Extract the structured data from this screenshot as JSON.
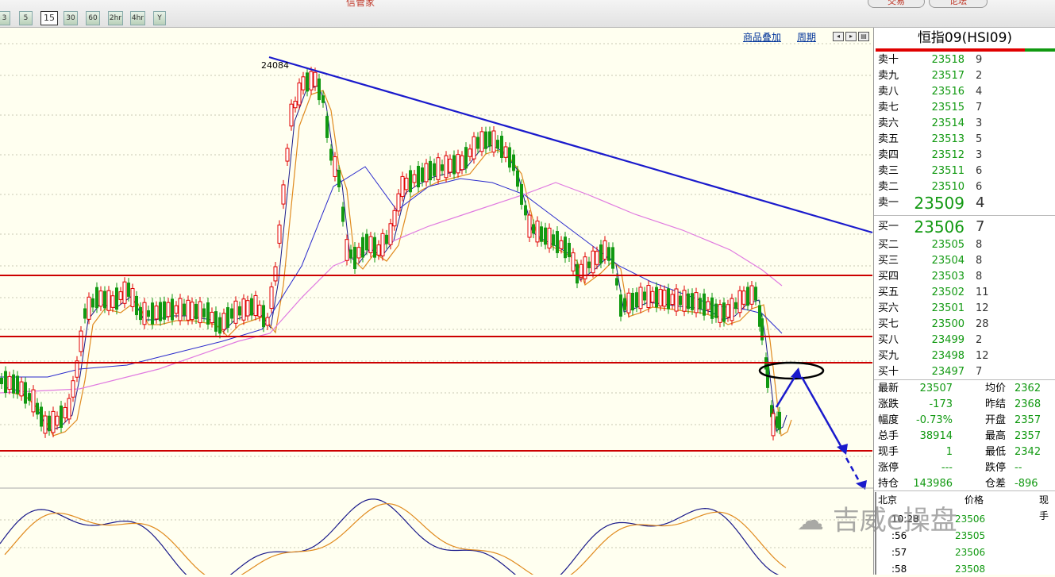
{
  "app": {
    "title": "信管家",
    "buttons": [
      "交易",
      "论坛"
    ]
  },
  "periods": [
    "3",
    "5",
    "15",
    "30",
    "60",
    "2hr",
    "4hr",
    "Y"
  ],
  "selected_period": "15",
  "chart_tools": {
    "overlay": "商品叠加",
    "cycle": "周期"
  },
  "chart": {
    "high_label": "24084"
  },
  "quote": {
    "title": "恒指09(HSI09)",
    "asks": [
      {
        "label": "卖十",
        "price": "23518",
        "vol": "9"
      },
      {
        "label": "卖九",
        "price": "23517",
        "vol": "2"
      },
      {
        "label": "卖八",
        "price": "23516",
        "vol": "4"
      },
      {
        "label": "卖七",
        "price": "23515",
        "vol": "7"
      },
      {
        "label": "卖六",
        "price": "23514",
        "vol": "3"
      },
      {
        "label": "卖五",
        "price": "23513",
        "vol": "5"
      },
      {
        "label": "卖四",
        "price": "23512",
        "vol": "3"
      },
      {
        "label": "卖三",
        "price": "23511",
        "vol": "6"
      },
      {
        "label": "卖二",
        "price": "23510",
        "vol": "6"
      },
      {
        "label": "卖一",
        "price": "23509",
        "vol": "4"
      }
    ],
    "bids": [
      {
        "label": "买一",
        "price": "23506",
        "vol": "7"
      },
      {
        "label": "买二",
        "price": "23505",
        "vol": "8"
      },
      {
        "label": "买三",
        "price": "23504",
        "vol": "8"
      },
      {
        "label": "买四",
        "price": "23503",
        "vol": "8"
      },
      {
        "label": "买五",
        "price": "23502",
        "vol": "11"
      },
      {
        "label": "买六",
        "price": "23501",
        "vol": "12"
      },
      {
        "label": "买七",
        "price": "23500",
        "vol": "28"
      },
      {
        "label": "买八",
        "price": "23499",
        "vol": "2"
      },
      {
        "label": "买九",
        "price": "23498",
        "vol": "12"
      },
      {
        "label": "买十",
        "price": "23497",
        "vol": "7"
      }
    ],
    "stats": [
      {
        "l1": "最新",
        "v1": "23507",
        "l2": "均价",
        "v2": "2362"
      },
      {
        "l1": "涨跌",
        "v1": "-173",
        "l2": "昨结",
        "v2": "2368"
      },
      {
        "l1": "幅度",
        "v1": "-0.73%",
        "l2": "开盘",
        "v2": "2357"
      },
      {
        "l1": "总手",
        "v1": "38914",
        "l2": "最高",
        "v2": "2357"
      },
      {
        "l1": "现手",
        "v1": "1",
        "l2": "最低",
        "v2": "2342"
      },
      {
        "l1": "涨停",
        "v1": "---",
        "l2": "跌停",
        "v2": "--"
      },
      {
        "l1": "持仓",
        "v1": "143986",
        "l2": "仓差",
        "v2": "-896"
      }
    ],
    "ticks_header": {
      "time": "北京",
      "price": "价格",
      "vol": "现手"
    },
    "ticks": [
      {
        "time": "10:28",
        "price": "23506"
      },
      {
        "time": ":56",
        "price": "23505"
      },
      {
        "time": ":57",
        "price": "23506"
      },
      {
        "time": ":58",
        "price": "23508"
      }
    ]
  },
  "watermark": "吉威e操盘",
  "colors": {
    "up": "#e00000",
    "down": "#119911",
    "trendline": "#0000cc",
    "support": "#cc0000"
  }
}
